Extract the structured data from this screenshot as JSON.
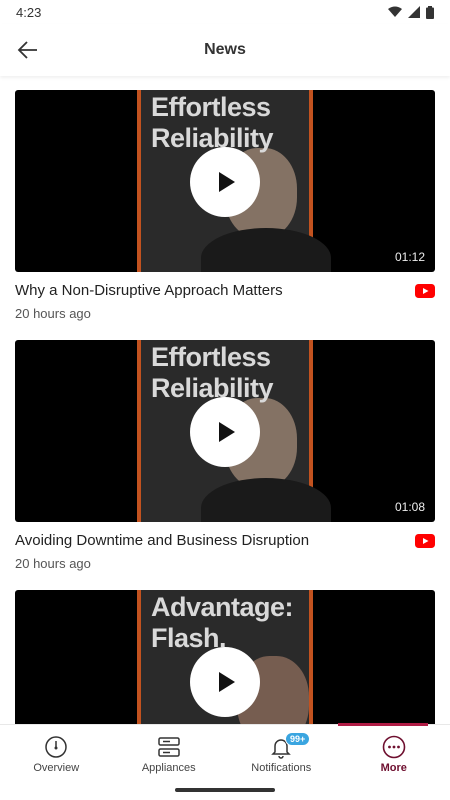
{
  "status_bar": {
    "time": "4:23"
  },
  "app_bar": {
    "title": "News"
  },
  "videos": [
    {
      "title": "Why a Non-Disruptive Approach Matters",
      "age": "20 hours ago",
      "duration": "01:12",
      "poster_text": "Effortless Reliability"
    },
    {
      "title": "Avoiding Downtime and Business Disruption",
      "age": "20 hours ago",
      "duration": "01:08",
      "poster_text": "Effortless Reliability"
    },
    {
      "title": "",
      "age": "",
      "duration": "",
      "poster_text": "Advantage: Flash."
    }
  ],
  "bottom_nav": {
    "items": [
      {
        "label": "Overview",
        "icon": "gauge-icon"
      },
      {
        "label": "Appliances",
        "icon": "server-icon"
      },
      {
        "label": "Notifications",
        "icon": "bell-icon",
        "badge": "99+"
      },
      {
        "label": "More",
        "icon": "more-icon",
        "active": true
      }
    ]
  },
  "colors": {
    "accent": "#6e0f2f",
    "badge": "#3aa5e0",
    "youtube": "#ff0000",
    "poster_stripe": "#c2521f"
  }
}
